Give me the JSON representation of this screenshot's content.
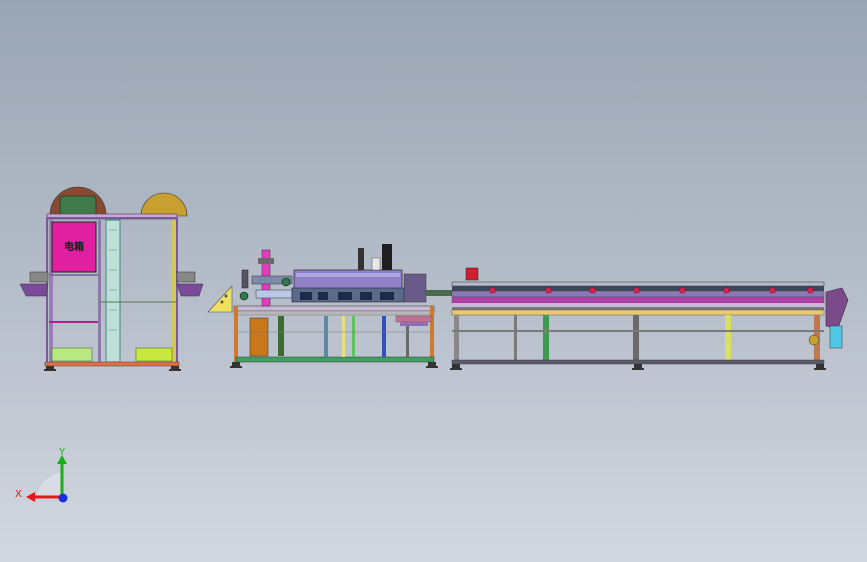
{
  "cabinet": {
    "label": "电箱"
  },
  "triad": {
    "y_label": "Y",
    "x_label": "X"
  },
  "colors": {
    "background_top": "#9aa5b3",
    "background_bottom": "#d3d8e0",
    "electrical_box": "#e020a0",
    "frame_purple": "#7b5a9a",
    "axis_x": "#e01818",
    "axis_y": "#18b018",
    "axis_z": "#1830e0"
  }
}
